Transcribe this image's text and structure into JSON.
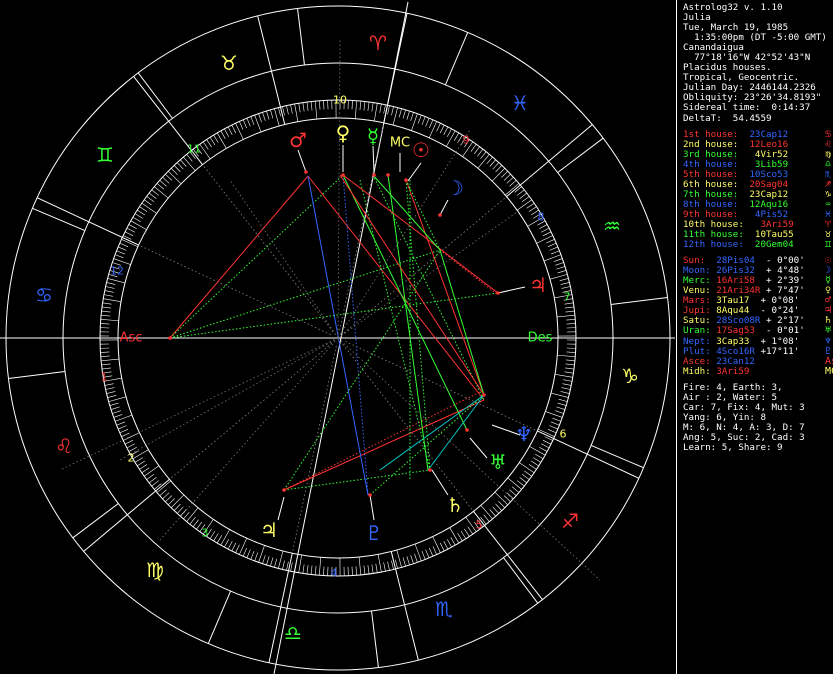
{
  "app": {
    "title": "Astrolog32 v. 1.10"
  },
  "chart_info": [
    "Julia",
    "Tue, March 19, 1985",
    "  1:35:00pm (DT -5:00 GMT)",
    "Canandaigua",
    "  77°18'16\"W 42°52'43\"N",
    "Placidus houses.",
    "Tropical, Geocentric.",
    "Julian Day: 2446144.2326",
    "Obliquity: 23°26'34.8193\"",
    "Sidereal time:  0:14:37",
    "DeltaT:  54.4559"
  ],
  "houses": [
    {
      "text": "1st house:  23Cap12",
      "hcolor": "#ff3333",
      "vcolor": "#3366ff",
      "sym": "♋",
      "scolor": "#ff3333"
    },
    {
      "text": "2nd house:  12Leo16",
      "hcolor": "#ffff66",
      "vcolor": "#ff3333",
      "sym": "♌",
      "scolor": "#ff3333"
    },
    {
      "text": "3rd house:   4Vir52",
      "hcolor": "#33ff33",
      "vcolor": "#ffff66",
      "sym": "♍",
      "scolor": "#ffff66"
    },
    {
      "text": "4th house:   3Lib59",
      "hcolor": "#3366ff",
      "vcolor": "#33ff33",
      "sym": "♎",
      "scolor": "#33ff33"
    },
    {
      "text": "5th house:  10Sco53",
      "hcolor": "#ff3333",
      "vcolor": "#3366ff",
      "sym": "♏",
      "scolor": "#3366ff"
    },
    {
      "text": "6th house:  20Sag04",
      "hcolor": "#ffff66",
      "vcolor": "#ff3333",
      "sym": "♐",
      "scolor": "#ff3333"
    },
    {
      "text": "7th house:  23Cap12",
      "hcolor": "#33ff33",
      "vcolor": "#ffff66",
      "sym": "♑",
      "scolor": "#ffff66"
    },
    {
      "text": "8th house:  12Aqu16",
      "hcolor": "#3366ff",
      "vcolor": "#33ff33",
      "sym": "♒",
      "scolor": "#33ff33"
    },
    {
      "text": "9th house:   4Pis52",
      "hcolor": "#ff3333",
      "vcolor": "#3366ff",
      "sym": "♓",
      "scolor": "#3366ff"
    },
    {
      "text": "10th house:   3Ari59",
      "hcolor": "#ffff66",
      "vcolor": "#ff3333",
      "sym": "♈",
      "scolor": "#ff3333"
    },
    {
      "text": "11th house:  10Tau55",
      "hcolor": "#33ff33",
      "vcolor": "#ffff66",
      "sym": "♉",
      "scolor": "#ffff66"
    },
    {
      "text": "12th house:  20Gem04",
      "hcolor": "#3366ff",
      "vcolor": "#33ff33",
      "sym": "♊",
      "scolor": "#33ff33"
    }
  ],
  "planets": [
    {
      "name": "Sun",
      "pos": "28Pis04",
      "rest": "  - 0°00'",
      "ncolor": "#ff3333",
      "pcolor": "#3366ff",
      "sym": "☉",
      "scolor": "#ff3333"
    },
    {
      "name": "Moon",
      "pos": "26Pis32",
      "rest": "  + 4°48'",
      "ncolor": "#3366ff",
      "pcolor": "#3366ff",
      "sym": "☽",
      "scolor": "#3366ff"
    },
    {
      "name": "Merc",
      "pos": "16Ari58",
      "rest": "  + 2°39'",
      "ncolor": "#33ff33",
      "pcolor": "#ff3333",
      "sym": "☿",
      "scolor": "#33ff33"
    },
    {
      "name": "Venu",
      "pos": "21Ari34R",
      "rest": " + 7°47'",
      "ncolor": "#ffff66",
      "pcolor": "#ff3333",
      "sym": "♀",
      "scolor": "#ffff66"
    },
    {
      "name": "Mars",
      "pos": "3Tau17",
      "rest": "  + 0°08'",
      "ncolor": "#ff3333",
      "pcolor": "#ffff66",
      "sym": "♂",
      "scolor": "#ff3333"
    },
    {
      "name": "Jupi",
      "pos": "8Aqu44",
      "rest": "  - 0°24'",
      "ncolor": "#ff3333",
      "pcolor": "#ffff66",
      "sym": "♃",
      "scolor": "#ff3333"
    },
    {
      "name": "Satu",
      "pos": "28Sco08R",
      "rest": " + 2°17'",
      "ncolor": "#ffff66",
      "pcolor": "#3366ff",
      "sym": "♄",
      "scolor": "#ffff66"
    },
    {
      "name": "Uran",
      "pos": "17Sag53",
      "rest": "  - 0°01'",
      "ncolor": "#33ff33",
      "pcolor": "#ff3333",
      "sym": "♅",
      "scolor": "#33ff33"
    },
    {
      "name": "Nept",
      "pos": "3Cap33",
      "rest": "  + 1°08'",
      "ncolor": "#3366ff",
      "pcolor": "#ffff66",
      "sym": "♆",
      "scolor": "#3366ff"
    },
    {
      "name": "Plut",
      "pos": "4Sco16R",
      "rest": " +17°11'",
      "ncolor": "#3366ff",
      "pcolor": "#3366ff",
      "sym": "♇",
      "scolor": "#3366ff"
    },
    {
      "name": "Asce",
      "pos": "23Can12",
      "rest": "",
      "ncolor": "#ff3333",
      "pcolor": "#3366ff",
      "sym": "Asc",
      "scolor": "#ff3333"
    },
    {
      "name": "Midh",
      "pos": "3Ari59",
      "rest": "",
      "ncolor": "#ffff66",
      "pcolor": "#ff3333",
      "sym": "MC",
      "scolor": "#ffff66"
    }
  ],
  "stats": [
    "Fire: 4, Earth: 3,",
    "Air : 2, Water: 5",
    "Car: 7, Fix: 4, Mut: 3",
    "Yang: 6, Yin: 8",
    "M: 6, N: 4, A: 3, D: 7",
    "Ang: 5, Suc: 2, Cad: 3",
    "Learn: 5, Share: 9"
  ],
  "wheel": {
    "angle_labels": {
      "asc": "Asc",
      "des": "Des"
    },
    "signs": [
      {
        "glyph": "♋",
        "color": "#3366ff"
      },
      {
        "glyph": "♌",
        "color": "#ff3333"
      },
      {
        "glyph": "♍",
        "color": "#ffff66"
      },
      {
        "glyph": "♎",
        "color": "#33ff33"
      },
      {
        "glyph": "♏",
        "color": "#3366ff"
      },
      {
        "glyph": "♐",
        "color": "#ff3333"
      },
      {
        "glyph": "♑",
        "color": "#ffff66"
      },
      {
        "glyph": "♒",
        "color": "#33ff33"
      },
      {
        "glyph": "♓",
        "color": "#3366ff"
      },
      {
        "glyph": "♈",
        "color": "#ff3333"
      },
      {
        "glyph": "♉",
        "color": "#ffff66"
      },
      {
        "glyph": "♊",
        "color": "#33ff33"
      }
    ],
    "house_numbers": [
      {
        "n": "1",
        "color": "#ff3333"
      },
      {
        "n": "2",
        "color": "#ffff66"
      },
      {
        "n": "3",
        "color": "#33ff33"
      },
      {
        "n": "4",
        "color": "#3366ff"
      },
      {
        "n": "5",
        "color": "#ff3333"
      },
      {
        "n": "6",
        "color": "#ffff66"
      },
      {
        "n": "7",
        "color": "#33ff33"
      },
      {
        "n": "8",
        "color": "#3366ff"
      },
      {
        "n": "9",
        "color": "#ff3333"
      },
      {
        "n": "10",
        "color": "#ffff66"
      },
      {
        "n": "11",
        "color": "#33ff33"
      },
      {
        "n": "12",
        "color": "#3366ff"
      }
    ],
    "planet_glyphs": [
      {
        "g": "♂",
        "color": "#ff3333"
      },
      {
        "g": "♀",
        "color": "#ffff66"
      },
      {
        "g": "☿",
        "color": "#33ff33"
      },
      {
        "g": "MC",
        "color": "#ffff66"
      },
      {
        "g": "☉",
        "color": "#ff3333"
      },
      {
        "g": "☽",
        "color": "#3366ff"
      },
      {
        "g": "♃",
        "color": "#ff3333"
      },
      {
        "g": "Des",
        "color": "#33ff33"
      },
      {
        "g": "♆",
        "color": "#3366ff"
      },
      {
        "g": "♅",
        "color": "#33ff33"
      },
      {
        "g": "♄",
        "color": "#ffff66"
      },
      {
        "g": "♇",
        "color": "#3366ff"
      },
      {
        "g": "♃",
        "color": "#ffff66"
      },
      {
        "g": "Asc",
        "color": "#ff3333"
      }
    ]
  }
}
